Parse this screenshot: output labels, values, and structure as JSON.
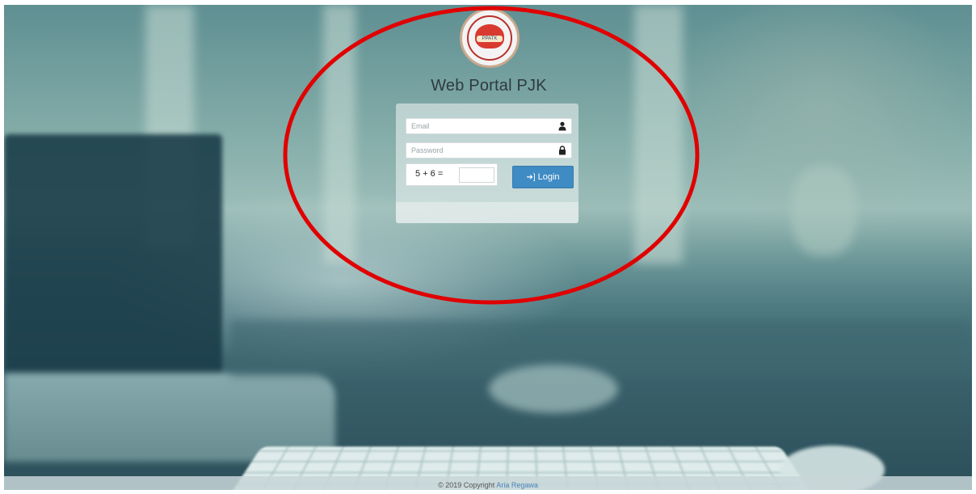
{
  "app": {
    "title": "Web Portal PJK",
    "logo_alt": "PPATK"
  },
  "login_form": {
    "email_placeholder": "Email",
    "password_placeholder": "Password",
    "captcha_question": "5 + 6 =",
    "captcha_answer": "",
    "login_label": "Login",
    "icons": {
      "email": "user-icon",
      "password": "lock-icon",
      "login": "sign-in-icon"
    }
  },
  "footer": {
    "copyright": "© 2019 Copyright",
    "author": "Aria Regawa"
  },
  "annotation": {
    "highlight_color": "#e00000"
  }
}
